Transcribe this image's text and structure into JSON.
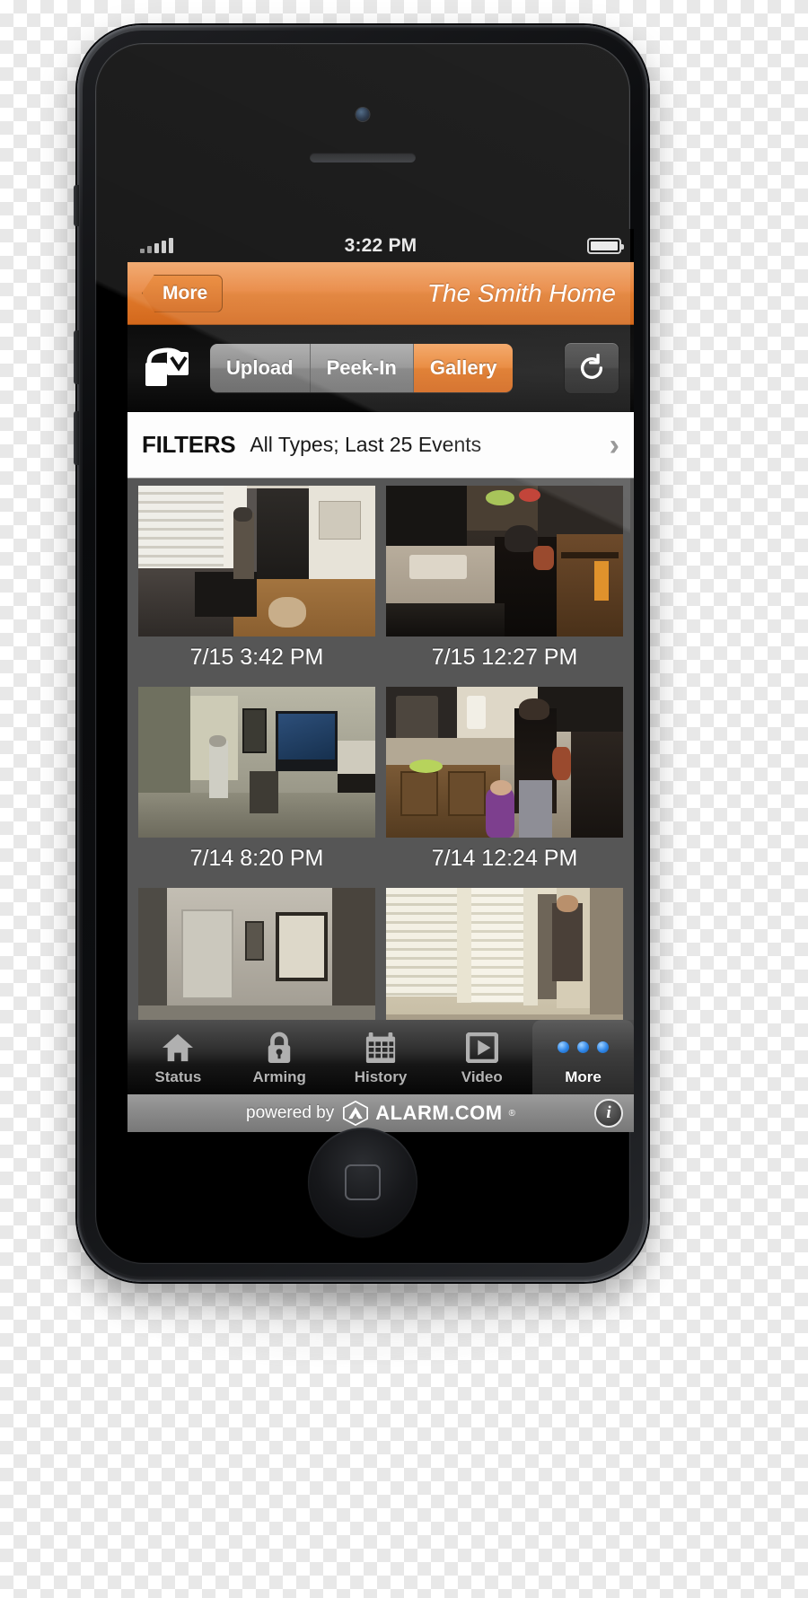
{
  "device": {
    "name": "smartphone-mockup",
    "home_button": "home-button"
  },
  "status_bar": {
    "signal_icon": "signal-bars-icon",
    "time": "3:22 PM",
    "battery_icon": "battery-full-icon"
  },
  "nav_bar": {
    "back_label": "More",
    "title": "The Smith Home"
  },
  "toolbar": {
    "camera_icon": "camera-upload-icon",
    "segments": [
      {
        "label": "Upload",
        "active": false
      },
      {
        "label": "Peek-In",
        "active": false
      },
      {
        "label": "Gallery",
        "active": true
      }
    ],
    "refresh_icon": "refresh-icon"
  },
  "filters": {
    "label": "FILTERS",
    "value": "All Types; Last 25 Events",
    "chevron_icon": "chevron-right-icon"
  },
  "gallery": {
    "items": [
      {
        "caption": "7/15 3:42 PM",
        "scene": "entryway-man-dog"
      },
      {
        "caption": "7/15 12:27 PM",
        "scene": "kitchen-woman-child"
      },
      {
        "caption": "7/14 8:20 PM",
        "scene": "livingroom-tv"
      },
      {
        "caption": "7/14 12:24 PM",
        "scene": "kitchen-sink-woman-child"
      },
      {
        "caption": "",
        "scene": "hallway-dim"
      },
      {
        "caption": "",
        "scene": "front-door-man"
      }
    ]
  },
  "tab_bar": {
    "tabs": [
      {
        "label": "Status",
        "icon": "home-icon",
        "active": false
      },
      {
        "label": "Arming",
        "icon": "lock-icon",
        "active": false
      },
      {
        "label": "History",
        "icon": "calendar-icon",
        "active": false
      },
      {
        "label": "Video",
        "icon": "play-icon",
        "active": false
      },
      {
        "label": "More",
        "icon": "dots-icon",
        "active": true
      }
    ]
  },
  "footer": {
    "powered_by": "powered by",
    "brand": "ALARM.COM",
    "registered_mark": "®",
    "logo_icon": "alarm-dot-com-logo-icon",
    "info_label": "i"
  },
  "colors": {
    "accent_orange": "#e8812f",
    "nav_orange_light": "#f0a263",
    "nav_orange_dark": "#d3681c",
    "gallery_bg": "#565656",
    "toolbar_dark": "#0d0d0d",
    "tab_active_blue": "#2f86e8"
  }
}
